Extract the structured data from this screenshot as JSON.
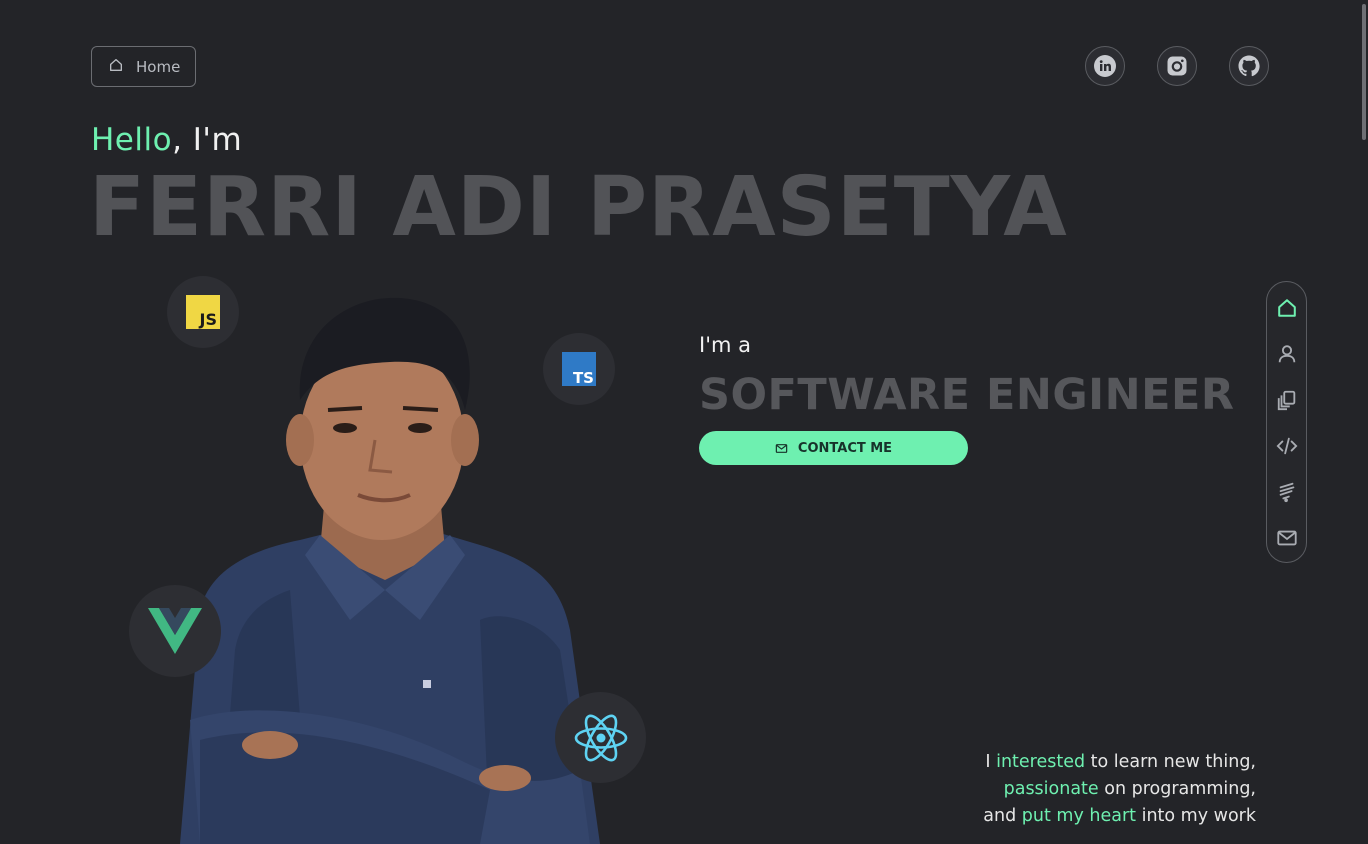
{
  "nav": {
    "home_label": "Home"
  },
  "social": [
    "linkedin-icon",
    "instagram-icon",
    "github-icon"
  ],
  "hero": {
    "hello": "Hello",
    "hello_rest": ", I'm",
    "name": "FERRI ADI PRASETYA",
    "im_a": "I'm a",
    "role": "SOFTWARE ENGINEER",
    "contact_label": "CONTACT ME"
  },
  "tech_badges": {
    "js": "JS",
    "ts": "TS"
  },
  "bio": {
    "line1_a": "I ",
    "line1_hl": "interested",
    "line1_b": " to learn new thing,",
    "line2_hl": "passionate",
    "line2_b": " on programming,",
    "line3_a": "and ",
    "line3_hl": "put my heart",
    "line3_b": " into my work"
  },
  "side_nav": [
    "home-icon",
    "user-icon",
    "copy-icon",
    "code-icon",
    "skills-icon",
    "mail-icon"
  ],
  "colors": {
    "accent": "#6ef0b0",
    "background": "#232428",
    "muted_heading": "#525357"
  }
}
